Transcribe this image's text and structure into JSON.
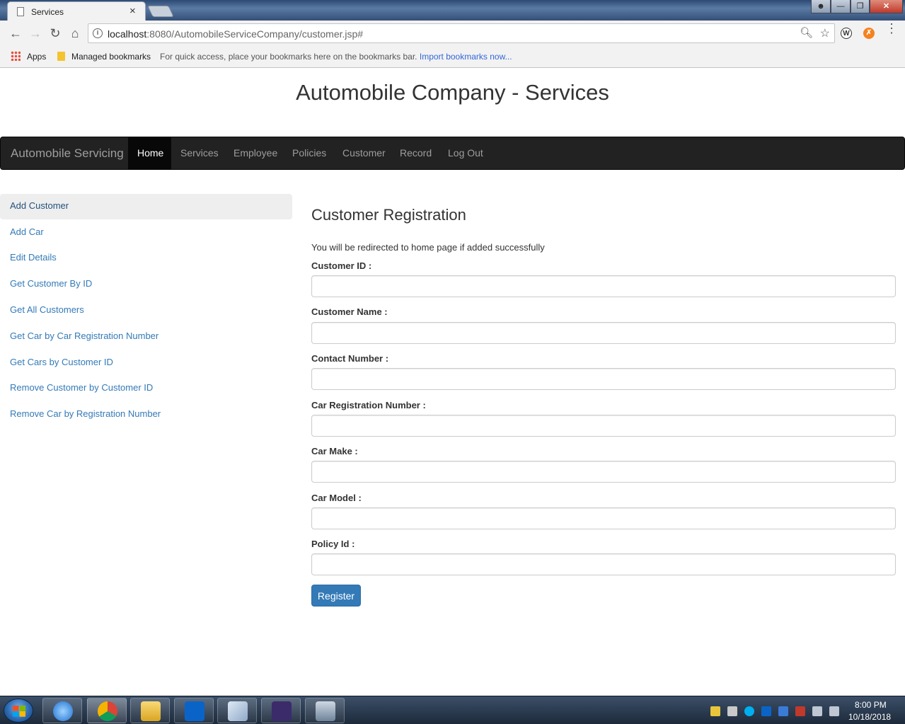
{
  "browser": {
    "tab_title": "Services",
    "tab_close": "×",
    "url_host": "localhost",
    "url_path": ":8080/AutomobileServiceCompany/customer.jsp#",
    "bookmarks": {
      "apps": "Apps",
      "managed": "Managed bookmarks",
      "hint": "For quick access, place your bookmarks here on the bookmarks bar.",
      "import_link": "Import bookmarks now..."
    },
    "extension_w": "W"
  },
  "page": {
    "title": "Automobile Company - Services"
  },
  "navbar": {
    "brand": "Automobile Servicing",
    "items": [
      {
        "label": "Home",
        "active": true
      },
      {
        "label": "Services"
      },
      {
        "label": "Employee"
      },
      {
        "label": "Policies"
      },
      {
        "label": "Customer"
      },
      {
        "label": "Record"
      },
      {
        "label": "Log Out"
      }
    ]
  },
  "sidebar": {
    "items": [
      {
        "label": "Add Customer",
        "active": true
      },
      {
        "label": "Add Car"
      },
      {
        "label": "Edit Details"
      },
      {
        "label": "Get Customer By ID"
      },
      {
        "label": "Get All Customers"
      },
      {
        "label": "Get Car by Car Registration Number"
      },
      {
        "label": "Get Cars by Customer ID"
      },
      {
        "label": "Remove Customer by Customer ID"
      },
      {
        "label": "Remove Car by Registration Number"
      }
    ]
  },
  "form": {
    "title": "Customer Registration",
    "note": "You will be redirected to home page if added successfully",
    "fields": [
      {
        "label": "Customer ID :",
        "value": ""
      },
      {
        "label": "Customer Name :",
        "value": ""
      },
      {
        "label": "Contact Number :",
        "value": ""
      },
      {
        "label": "Car Registration Number :",
        "value": ""
      },
      {
        "label": "Car Make :",
        "value": ""
      },
      {
        "label": "Car Model :",
        "value": ""
      },
      {
        "label": "Policy Id :",
        "value": ""
      }
    ],
    "submit_label": "Register"
  },
  "taskbar": {
    "time": "8:00 PM",
    "date": "10/18/2018"
  },
  "colors": {
    "navbar_bg": "#222222",
    "link": "#337ab7",
    "primary_button": "#337ab7"
  }
}
